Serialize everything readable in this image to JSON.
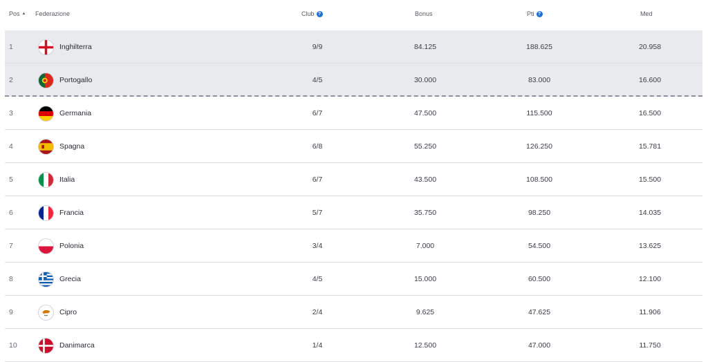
{
  "header": {
    "pos": "Pos",
    "federazione": "Federazione",
    "club": "Club",
    "bonus": "Bonus",
    "pti": "Pti",
    "med": "Med",
    "info_glyph": "?",
    "sort_glyph": "▲"
  },
  "rows": [
    {
      "pos": "1",
      "name": "Inghilterra",
      "flag": "england-flag-icon",
      "club": "9/9",
      "bonus": "84.125",
      "pti": "188.625",
      "med": "20.958"
    },
    {
      "pos": "2",
      "name": "Portogallo",
      "flag": "portugal-flag-icon",
      "club": "4/5",
      "bonus": "30.000",
      "pti": "83.000",
      "med": "16.600"
    },
    {
      "pos": "3",
      "name": "Germania",
      "flag": "germany-flag-icon",
      "club": "6/7",
      "bonus": "47.500",
      "pti": "115.500",
      "med": "16.500"
    },
    {
      "pos": "4",
      "name": "Spagna",
      "flag": "spain-flag-icon",
      "club": "6/8",
      "bonus": "55.250",
      "pti": "126.250",
      "med": "15.781"
    },
    {
      "pos": "5",
      "name": "Italia",
      "flag": "italy-flag-icon",
      "club": "6/7",
      "bonus": "43.500",
      "pti": "108.500",
      "med": "15.500"
    },
    {
      "pos": "6",
      "name": "Francia",
      "flag": "france-flag-icon",
      "club": "5/7",
      "bonus": "35.750",
      "pti": "98.250",
      "med": "14.035"
    },
    {
      "pos": "7",
      "name": "Polonia",
      "flag": "poland-flag-icon",
      "club": "3/4",
      "bonus": "7.000",
      "pti": "54.500",
      "med": "13.625"
    },
    {
      "pos": "8",
      "name": "Grecia",
      "flag": "greece-flag-icon",
      "club": "4/5",
      "bonus": "15.000",
      "pti": "60.500",
      "med": "12.100"
    },
    {
      "pos": "9",
      "name": "Cipro",
      "flag": "cyprus-flag-icon",
      "club": "2/4",
      "bonus": "9.625",
      "pti": "47.625",
      "med": "11.906"
    },
    {
      "pos": "10",
      "name": "Danimarca",
      "flag": "denmark-flag-icon",
      "club": "1/4",
      "bonus": "12.500",
      "pti": "47.000",
      "med": "11.750"
    }
  ],
  "colors": {
    "accent": "#1f6fd6",
    "highlight_row": "#e8eaee",
    "separator": "#8a8f9c"
  }
}
